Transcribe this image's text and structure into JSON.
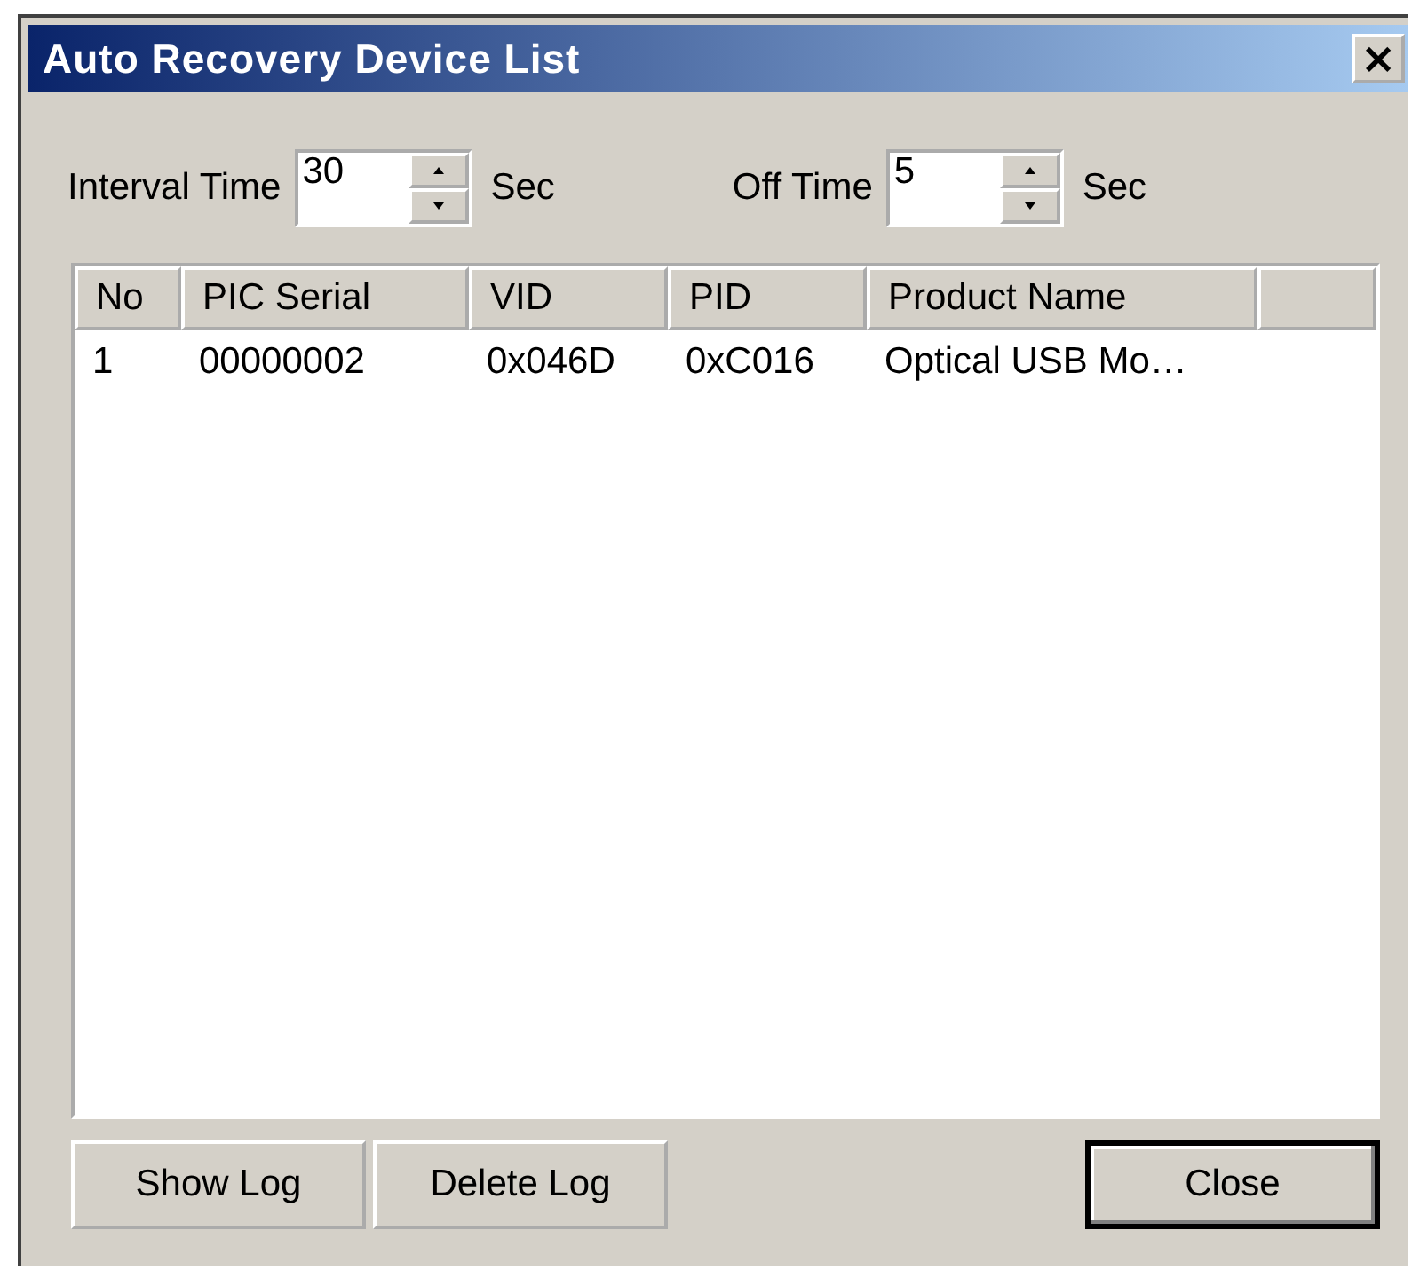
{
  "window": {
    "title": "Auto Recovery Device List",
    "close": "×"
  },
  "spinners": [
    {
      "label": "Interval Time",
      "value": "30",
      "unit": "Sec"
    },
    {
      "label": "Off Time",
      "value": "5",
      "unit": "Sec"
    }
  ],
  "table": {
    "columns": [
      "No",
      "PIC Serial",
      "VID",
      "PID",
      "Product Name"
    ],
    "rows": [
      [
        "1",
        "00000002",
        "0x046D",
        "0xC016",
        "Optical USB Mo…"
      ]
    ]
  },
  "buttons": [
    {
      "label": "Show Log",
      "kind": "normal"
    },
    {
      "label": "Delete Log",
      "kind": "normal"
    },
    {
      "label": "Close",
      "kind": "default"
    }
  ]
}
